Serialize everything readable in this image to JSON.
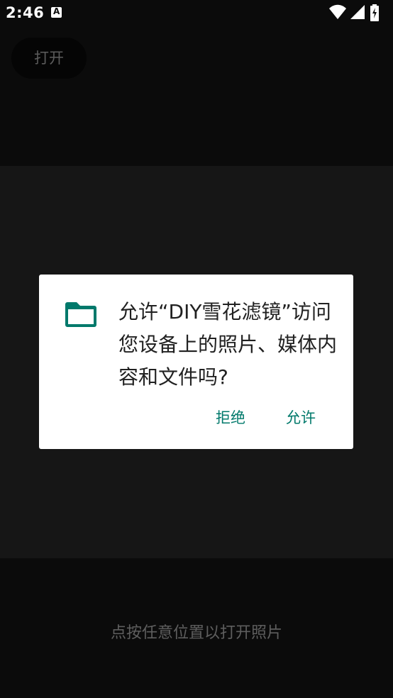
{
  "status_bar": {
    "time": "2:46",
    "icons": [
      "notification-a-icon",
      "wifi-icon",
      "signal-icon",
      "battery-charging-icon"
    ]
  },
  "app": {
    "open_button_label": "打开",
    "hint": "点按任意位置以打开照片"
  },
  "dialog": {
    "icon": "folder-icon",
    "message": "允许“DIY雪花滤镜”访问您设备上的照片、媒体内容和文件吗?",
    "deny_label": "拒绝",
    "allow_label": "允许"
  },
  "colors": {
    "accent": "#00796b",
    "background": "#0b0b0b",
    "dialog_background": "#ffffff"
  }
}
